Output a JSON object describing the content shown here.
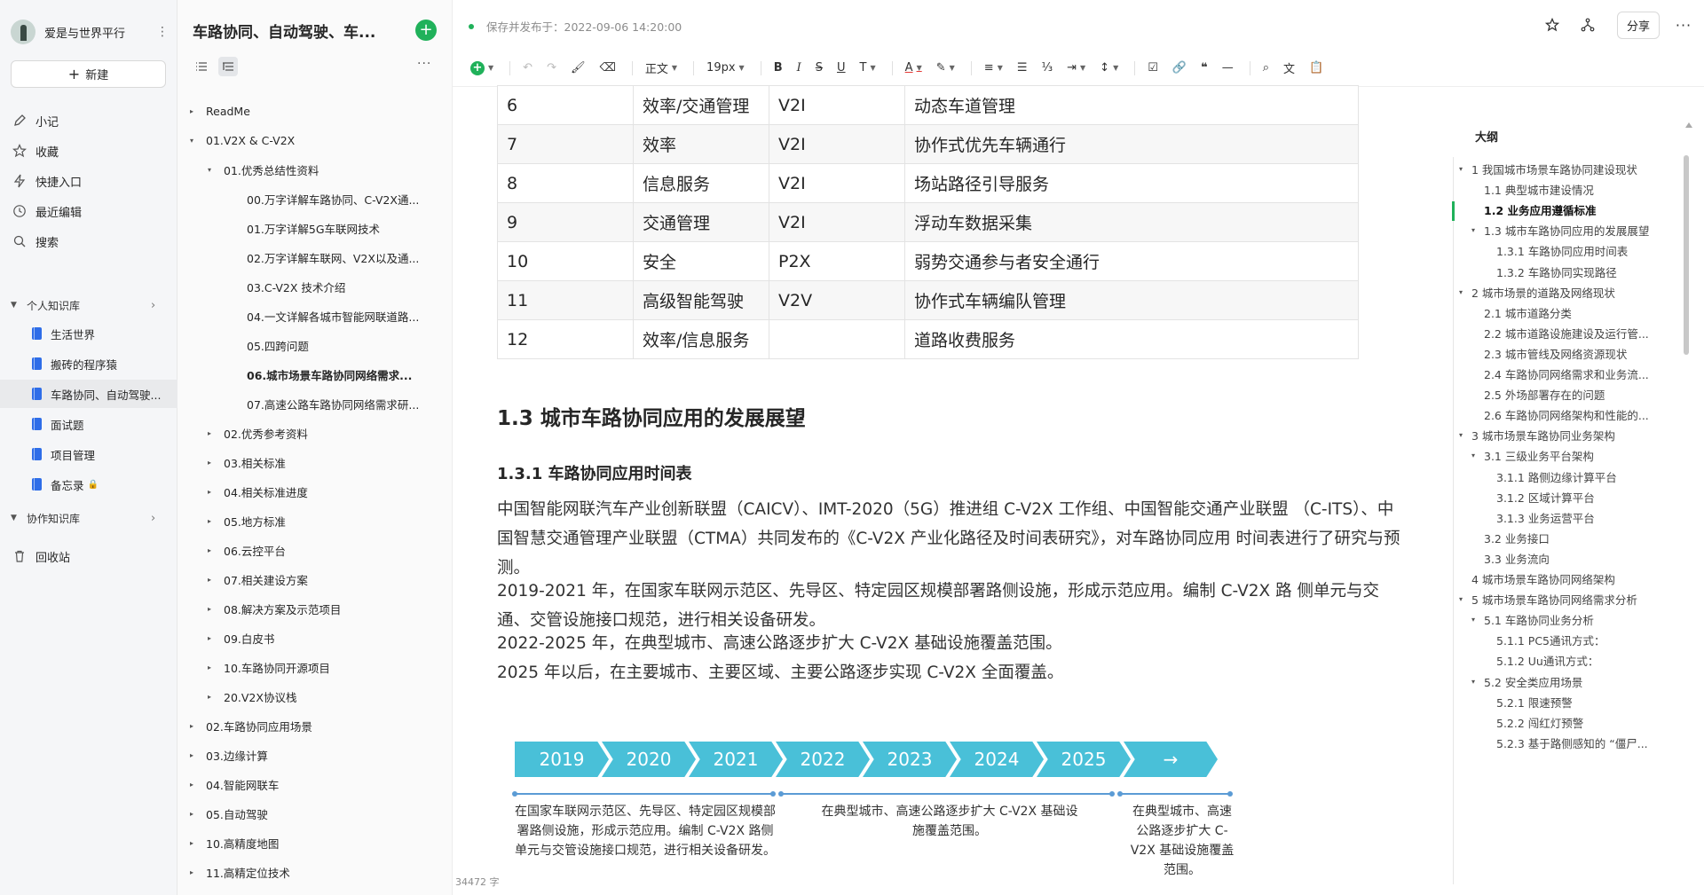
{
  "user": {
    "name": "爱是与世界平行"
  },
  "sidebar": {
    "new_label": "新建",
    "nav": [
      "小记",
      "收藏",
      "快捷入口",
      "最近编辑",
      "搜索"
    ],
    "personal_label": "个人知识库",
    "books": [
      "生活世界",
      "搬砖的程序猿",
      "车路协同、自动驾驶...",
      "面试题",
      "项目管理",
      "备忘录"
    ],
    "collab_label": "协作知识库",
    "trash_label": "回收站"
  },
  "tree": {
    "title": "车路协同、自动驾驶、车...",
    "items": [
      {
        "label": "ReadMe",
        "arrow": "▸",
        "bold": false
      },
      {
        "label": "01.V2X & C-V2X",
        "arrow": "▾",
        "bold": false
      },
      {
        "label": "01.优秀总结性资料",
        "arrow": "▾",
        "bold": false
      },
      {
        "label": "00.万字详解车路协同、C-V2X通...",
        "arrow": "",
        "bold": false
      },
      {
        "label": "01.万字详解5G车联网技术",
        "arrow": "",
        "bold": false
      },
      {
        "label": "02.万字详解车联网、V2X以及通...",
        "arrow": "",
        "bold": false
      },
      {
        "label": "03.C-V2X 技术介绍",
        "arrow": "",
        "bold": false
      },
      {
        "label": "04.一文详解各城市智能网联道路...",
        "arrow": "",
        "bold": false
      },
      {
        "label": "05.四跨问题",
        "arrow": "",
        "bold": false
      },
      {
        "label": "06.城市场景车路协同网络需求...",
        "arrow": "",
        "bold": true
      },
      {
        "label": "07.高速公路车路协同网络需求研...",
        "arrow": "",
        "bold": false
      },
      {
        "label": "02.优秀参考资料",
        "arrow": "▸",
        "bold": false
      },
      {
        "label": "03.相关标准",
        "arrow": "▸",
        "bold": false
      },
      {
        "label": "04.相关标准进度",
        "arrow": "▸",
        "bold": false
      },
      {
        "label": "05.地方标准",
        "arrow": "▸",
        "bold": false
      },
      {
        "label": "06.云控平台",
        "arrow": "▸",
        "bold": false
      },
      {
        "label": "07.相关建设方案",
        "arrow": "▸",
        "bold": false
      },
      {
        "label": "08.解决方案及示范项目",
        "arrow": "▸",
        "bold": false
      },
      {
        "label": "09.白皮书",
        "arrow": "▸",
        "bold": false
      },
      {
        "label": "10.车路协同开源项目",
        "arrow": "▸",
        "bold": false
      },
      {
        "label": "20.V2X协议栈",
        "arrow": "▸",
        "bold": false
      },
      {
        "label": "02.车路协同应用场景",
        "arrow": "▸",
        "bold": false
      },
      {
        "label": "03.边缘计算",
        "arrow": "▸",
        "bold": false
      },
      {
        "label": "04.智能网联车",
        "arrow": "▸",
        "bold": false
      },
      {
        "label": "05.自动驾驶",
        "arrow": "▸",
        "bold": false
      },
      {
        "label": "10.高精度地图",
        "arrow": "▸",
        "bold": false
      },
      {
        "label": "11.高精定位技术",
        "arrow": "▸",
        "bold": false
      }
    ]
  },
  "header": {
    "status": "保存并发布于：2022-09-06 14:20:00",
    "share_label": "分享"
  },
  "toolbar": {
    "style": "正文",
    "font_size": "19px"
  },
  "table_rows": [
    [
      "6",
      "效率/交通管理",
      "V2I",
      "动态车道管理"
    ],
    [
      "7",
      "效率",
      "V2I",
      "协作式优先车辆通行"
    ],
    [
      "8",
      "信息服务",
      "V2I",
      "场站路径引导服务"
    ],
    [
      "9",
      "交通管理",
      "V2I",
      "浮动车数据采集"
    ],
    [
      "10",
      "安全",
      "P2X",
      "弱势交通参与者安全通行"
    ],
    [
      "11",
      "高级智能驾驶",
      "V2V",
      "协作式车辆编队管理"
    ],
    [
      "12",
      "效率/信息服务",
      "",
      "道路收费服务"
    ]
  ],
  "doc": {
    "h2": "1.3 城市车路协同应用的发展展望",
    "h3": "1.3.1 车路协同应用时间表",
    "p1": "中国智能网联汽车产业创新联盟（CAICV）、IMT-2020（5G）推进组 C-V2X 工作组、中国智能交通产业联盟 （C-ITS）、中国智慧交通管理产业联盟（CTMA）共同发布的《C-V2X 产业化路径及时间表研究》，对车路协同应用 时间表进行了研究与预测。",
    "p2": "2019-2021 年，在国家车联网示范区、先导区、特定园区规模部署路侧设施，形成示范应用。编制 C-V2X 路 侧单元与交通、交管设施接口规范，进行相关设备研发。",
    "p3": "2022-2025 年，在典型城市、高速公路逐步扩大 C-V2X 基础设施覆盖范围。",
    "p4": "2025 年以后，在主要城市、主要区域、主要公路逐步实现 C-V2X 全面覆盖。",
    "word_count": "34472 字"
  },
  "timeline": {
    "years": [
      "2019",
      "2020",
      "2021",
      "2022",
      "2023",
      "2024",
      "2025",
      "→"
    ],
    "desc1": "在国家车联网示范区、先导区、特定园区规模部署路侧设施，形成示范应用。编制 C-V2X 路侧单元与交管设施接口规范，进行相关设备研发。",
    "desc2": "在典型城市、高速公路逐步扩大 C-V2X 基础设施覆盖范围。",
    "desc3": "在典型城市、高速公路逐步扩大 C-V2X 基础设施覆盖范围。"
  },
  "outline": {
    "title": "大纲",
    "items": [
      {
        "label": "1 我国城市场景车路协同建设现状",
        "arrow": "▾",
        "active": false
      },
      {
        "label": "1.1 典型城市建设情况",
        "arrow": "",
        "active": false
      },
      {
        "label": "1.2 业务应用遵循标准",
        "arrow": "",
        "active": true
      },
      {
        "label": "1.3 城市车路协同应用的发展展望",
        "arrow": "▾",
        "active": false
      },
      {
        "label": "1.3.1 车路协同应用时间表",
        "arrow": "",
        "active": false
      },
      {
        "label": "1.3.2 车路协同实现路径",
        "arrow": "",
        "active": false
      },
      {
        "label": "2 城市场景的道路及网络现状",
        "arrow": "▾",
        "active": false
      },
      {
        "label": "2.1 城市道路分类",
        "arrow": "",
        "active": false
      },
      {
        "label": "2.2 城市道路设施建设及运行管...",
        "arrow": "",
        "active": false
      },
      {
        "label": "2.3 城市管线及网络资源现状",
        "arrow": "",
        "active": false
      },
      {
        "label": "2.4 车路协同网络需求和业务流...",
        "arrow": "",
        "active": false
      },
      {
        "label": "2.5 外场部署存在的问题",
        "arrow": "",
        "active": false
      },
      {
        "label": "2.6 车路协同网络架构和性能的...",
        "arrow": "",
        "active": false
      },
      {
        "label": "3 城市场景车路协同业务架构",
        "arrow": "▾",
        "active": false
      },
      {
        "label": "3.1 三级业务平台架构",
        "arrow": "▾",
        "active": false
      },
      {
        "label": "3.1.1 路侧边缘计算平台",
        "arrow": "",
        "active": false
      },
      {
        "label": "3.1.2 区域计算平台",
        "arrow": "",
        "active": false
      },
      {
        "label": "3.1.3 业务运营平台",
        "arrow": "",
        "active": false
      },
      {
        "label": "3.2 业务接口",
        "arrow": "",
        "active": false
      },
      {
        "label": "3.3 业务流向",
        "arrow": "",
        "active": false
      },
      {
        "label": "4 城市场景车路协同网络架构",
        "arrow": "",
        "active": false
      },
      {
        "label": "5 城市场景车路协同网络需求分析",
        "arrow": "▾",
        "active": false
      },
      {
        "label": "5.1 车路协同业务分析",
        "arrow": "▾",
        "active": false
      },
      {
        "label": "5.1.1 PC5通讯方式：",
        "arrow": "",
        "active": false
      },
      {
        "label": "5.1.2 Uu通讯方式：",
        "arrow": "",
        "active": false
      },
      {
        "label": "5.2 安全类应用场景",
        "arrow": "▾",
        "active": false
      },
      {
        "label": "5.2.1 限速预警",
        "arrow": "",
        "active": false
      },
      {
        "label": "5.2.2 闯红灯预警",
        "arrow": "",
        "active": false
      },
      {
        "label": "5.2.3 基于路侧感知的 “僵尸...",
        "arrow": "",
        "active": false
      }
    ]
  }
}
